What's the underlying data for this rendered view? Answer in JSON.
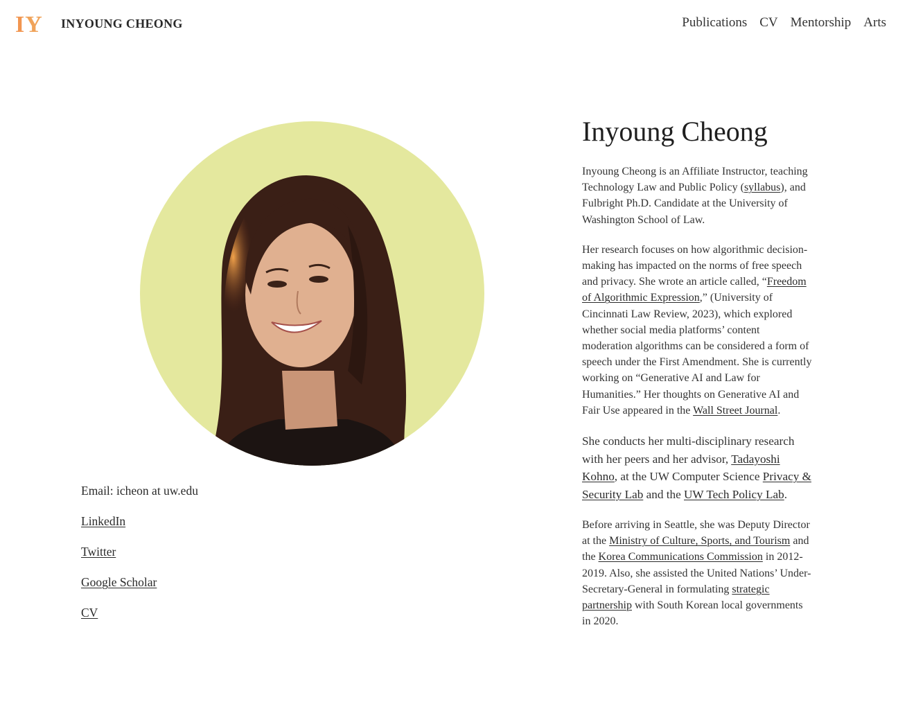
{
  "header": {
    "logo_i": "I",
    "logo_y": "Y",
    "site_title": "INYOUNG CHEONG",
    "nav": [
      "Publications",
      "CV",
      "Mentorship",
      "Arts"
    ]
  },
  "photo": {
    "alt": "Portrait of Inyoung Cheong",
    "bg_color": "#e4e89e"
  },
  "contact": {
    "email": "Email: icheon at uw.edu",
    "links": [
      "LinkedIn",
      "Twitter",
      "Google Scholar",
      "CV"
    ]
  },
  "bio": {
    "name": "Inyoung Cheong",
    "p1": {
      "a": "Inyoung Cheong is an Affiliate Instructor, teaching Technology Law and Public Policy (",
      "link": "syllabus",
      "b": "), and Fulbright Ph.D. Candidate at the University of Washington School of Law."
    },
    "p2": {
      "a": "Her research focuses on how algorithmic decision-making has impacted on the norms of free speech and privacy. She wrote an article called, “",
      "link1": "Freedom of Algorithmic Expression",
      "b": ",” (University of Cincinnati Law Review, 2023), which explored whether social media platforms’ content moderation algorithms can be considered a form of speech under the First Amendment. She is currently working on “Generative AI and Law for Humanities.” Her thoughts on Generative AI and Fair Use appeared in the ",
      "link2": "Wall Street Journal",
      "c": "."
    },
    "p3": {
      "a": "She conducts her multi-disciplinary research with her peers and her advisor, ",
      "link1": "Tadayoshi Kohno",
      "b": ", at the UW Computer Science ",
      "link2": "Privacy & Security Lab",
      "c": " and the ",
      "link3": "UW Tech Policy Lab",
      "d": "."
    },
    "p4": {
      "a": "Before arriving in Seattle, she was Deputy Director at the ",
      "link1": "Ministry of Culture, Sports, and Tourism",
      "b": " and the ",
      "link2": "Korea Communications Commission",
      "c": " in 2012-2019. Also, she assisted the United Nations’ Under-Secretary-General in formulating ",
      "link3": "strategic partnership",
      "d": " with South Korean local governments in 2020."
    }
  }
}
